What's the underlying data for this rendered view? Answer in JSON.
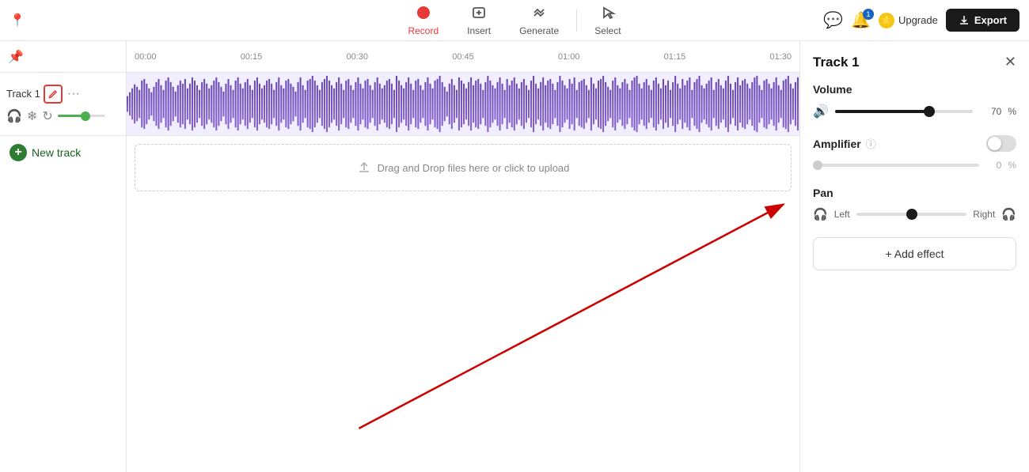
{
  "toolbar": {
    "record_label": "Record",
    "insert_label": "Insert",
    "generate_label": "Generate",
    "select_label": "Select",
    "export_label": "Export",
    "upgrade_label": "Upgrade",
    "bell_badge": "1"
  },
  "ruler": {
    "marks": [
      "00:00",
      "00:15",
      "00:30",
      "00:45",
      "01:00",
      "01:15",
      "01:30"
    ]
  },
  "track": {
    "name": "Track 1",
    "volume_value": "70",
    "volume_percent": "%"
  },
  "upload_zone": {
    "text": "Drag and Drop files here or click to upload"
  },
  "right_panel": {
    "title": "Track 1",
    "volume_label": "Volume",
    "volume_value": "70",
    "volume_percent": "%",
    "amplifier_label": "Amplifier",
    "amp_value": "0",
    "amp_percent": "%",
    "pan_label": "Pan",
    "pan_left": "Left",
    "pan_right": "Right",
    "add_effect_label": "+ Add effect"
  },
  "new_track": {
    "label": "New track"
  }
}
